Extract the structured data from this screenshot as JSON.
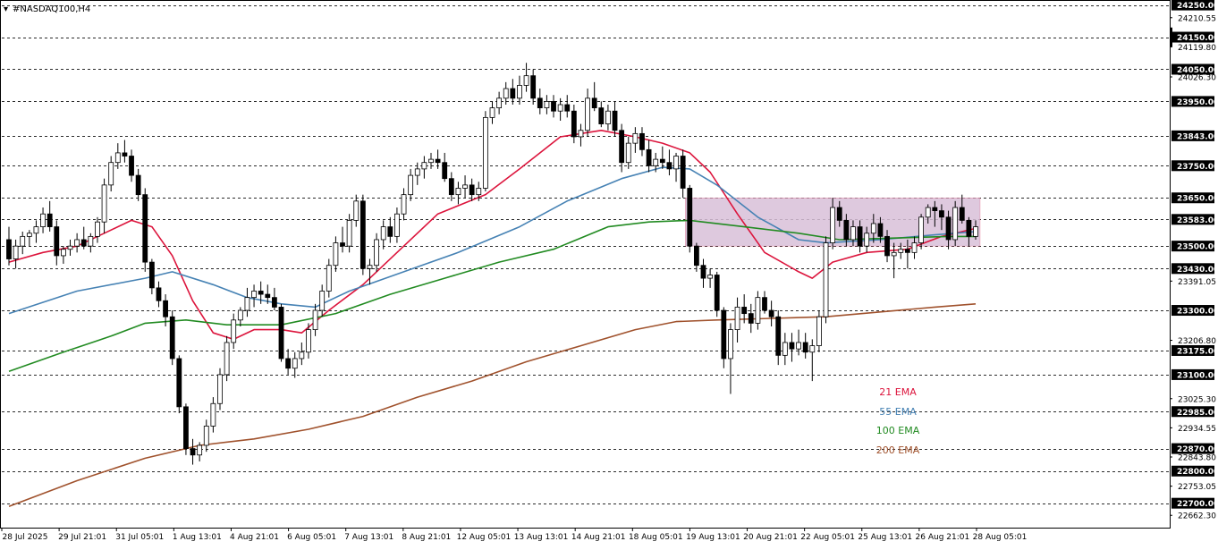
{
  "window": {
    "title": "#NASDAQ100,H4"
  },
  "colors": {
    "background": "#ffffff",
    "grid": "#2b2b2b",
    "candle_bull_fill": "#ffffff",
    "candle_bear_fill": "#000000",
    "candle_outline": "#000000",
    "ema21": "#dc143c",
    "ema55": "#4682b4",
    "ema100": "#228b22",
    "ema200": "#a0522d",
    "zone_fill": "#d8bfd8",
    "level_label_bg": "#000000",
    "level_label_text": "#ffffff"
  },
  "chart_data": {
    "type": "candlestick",
    "symbol": "#NASDAQ100",
    "timeframe": "H4",
    "ylim": [
      22624,
      24260
    ],
    "y_ticks": [
      "24210.55",
      "24119.80",
      "24026.30",
      "23391.05",
      "23206.80",
      "23025.30",
      "22934.55",
      "22843.80",
      "22753.05",
      "22662.30"
    ],
    "horizontal_levels": [
      {
        "value": 24250.0,
        "label": "24250.00"
      },
      {
        "value": 24150.0,
        "label": "24150.00"
      },
      {
        "value": 24050.0,
        "label": "24050.00"
      },
      {
        "value": 23950.0,
        "label": "23950.00"
      },
      {
        "value": 23843.0,
        "label": "23843.00"
      },
      {
        "value": 23750.0,
        "label": "23750.00"
      },
      {
        "value": 23650.0,
        "label": "23650.00"
      },
      {
        "value": 23583.0,
        "label": "23583.00"
      },
      {
        "value": 23500.0,
        "label": "23500.00"
      },
      {
        "value": 23430.0,
        "label": "23430.00"
      },
      {
        "value": 23300.0,
        "label": "23300.00"
      },
      {
        "value": 23175.0,
        "label": "23175.00"
      },
      {
        "value": 23100.0,
        "label": "23100.00"
      },
      {
        "value": 22985.0,
        "label": "22985.00"
      },
      {
        "value": 22870.0,
        "label": "22870.00"
      },
      {
        "value": 22800.0,
        "label": "22800.00"
      },
      {
        "value": 22700.0,
        "label": "22700.00"
      }
    ],
    "x_tick_labels": [
      "28 Jul 2025",
      "29 Jul 21:01",
      "31 Jul 05:01",
      "1 Aug 13:01",
      "4 Aug 21:01",
      "6 Aug 05:01",
      "7 Aug 13:01",
      "8 Aug 21:01",
      "12 Aug 05:01",
      "13 Aug 13:01",
      "14 Aug 21:01",
      "18 Aug 05:01",
      "19 Aug 13:01",
      "20 Aug 21:01",
      "22 Aug 05:01",
      "25 Aug 13:01",
      "26 Aug 21:01",
      "28 Aug 05:01"
    ],
    "candles": [
      [
        23520,
        23560,
        23440,
        23460
      ],
      [
        23460,
        23520,
        23430,
        23500
      ],
      [
        23500,
        23545,
        23475,
        23530
      ],
      [
        23530,
        23550,
        23500,
        23540
      ],
      [
        23540,
        23580,
        23510,
        23560
      ],
      [
        23560,
        23620,
        23540,
        23600
      ],
      [
        23600,
        23640,
        23545,
        23560
      ],
      [
        23560,
        23580,
        23440,
        23470
      ],
      [
        23470,
        23500,
        23445,
        23490
      ],
      [
        23490,
        23520,
        23470,
        23500
      ],
      [
        23500,
        23540,
        23480,
        23520
      ],
      [
        23520,
        23560,
        23490,
        23500
      ],
      [
        23500,
        23540,
        23480,
        23530
      ],
      [
        23530,
        23590,
        23510,
        23575
      ],
      [
        23575,
        23710,
        23540,
        23690
      ],
      [
        23690,
        23780,
        23670,
        23760
      ],
      [
        23760,
        23820,
        23740,
        23790
      ],
      [
        23790,
        23830,
        23760,
        23780
      ],
      [
        23780,
        23800,
        23700,
        23720
      ],
      [
        23720,
        23740,
        23640,
        23660
      ],
      [
        23660,
        23680,
        23420,
        23450
      ],
      [
        23450,
        23460,
        23350,
        23370
      ],
      [
        23370,
        23390,
        23310,
        23330
      ],
      [
        23330,
        23350,
        23250,
        23280
      ],
      [
        23280,
        23300,
        23130,
        23150
      ],
      [
        23150,
        23160,
        22980,
        23000
      ],
      [
        23000,
        23010,
        22850,
        22870
      ],
      [
        22870,
        22900,
        22820,
        22850
      ],
      [
        22850,
        22890,
        22830,
        22880
      ],
      [
        22880,
        22960,
        22860,
        22940
      ],
      [
        22940,
        23030,
        22920,
        23010
      ],
      [
        23010,
        23120,
        22990,
        23100
      ],
      [
        23100,
        23220,
        23080,
        23200
      ],
      [
        23200,
        23290,
        23180,
        23270
      ],
      [
        23270,
        23310,
        23250,
        23300
      ],
      [
        23300,
        23370,
        23280,
        23340
      ],
      [
        23340,
        23380,
        23310,
        23360
      ],
      [
        23360,
        23390,
        23320,
        23350
      ],
      [
        23350,
        23380,
        23320,
        23340
      ],
      [
        23340,
        23370,
        23300,
        23310
      ],
      [
        23310,
        23320,
        23140,
        23150
      ],
      [
        23150,
        23180,
        23100,
        23120
      ],
      [
        23120,
        23170,
        23090,
        23150
      ],
      [
        23150,
        23200,
        23130,
        23170
      ],
      [
        23170,
        23260,
        23150,
        23240
      ],
      [
        23240,
        23320,
        23220,
        23300
      ],
      [
        23300,
        23380,
        23280,
        23360
      ],
      [
        23360,
        23460,
        23340,
        23440
      ],
      [
        23440,
        23530,
        23420,
        23510
      ],
      [
        23510,
        23560,
        23480,
        23500
      ],
      [
        23500,
        23600,
        23480,
        23580
      ],
      [
        23580,
        23660,
        23560,
        23640
      ],
      [
        23640,
        23660,
        23410,
        23430
      ],
      [
        23430,
        23460,
        23380,
        23440
      ],
      [
        23440,
        23540,
        23420,
        23520
      ],
      [
        23520,
        23580,
        23490,
        23560
      ],
      [
        23560,
        23590,
        23510,
        23530
      ],
      [
        23530,
        23620,
        23510,
        23600
      ],
      [
        23600,
        23680,
        23580,
        23660
      ],
      [
        23660,
        23740,
        23640,
        23720
      ],
      [
        23720,
        23760,
        23690,
        23740
      ],
      [
        23740,
        23780,
        23710,
        23760
      ],
      [
        23760,
        23790,
        23740,
        23770
      ],
      [
        23770,
        23800,
        23740,
        23760
      ],
      [
        23760,
        23790,
        23700,
        23710
      ],
      [
        23710,
        23730,
        23640,
        23660
      ],
      [
        23660,
        23700,
        23630,
        23680
      ],
      [
        23680,
        23720,
        23650,
        23690
      ],
      [
        23690,
        23710,
        23640,
        23660
      ],
      [
        23660,
        23700,
        23640,
        23680
      ],
      [
        23680,
        23920,
        23670,
        23900
      ],
      [
        23900,
        23950,
        23880,
        23930
      ],
      [
        23930,
        23980,
        23910,
        23960
      ],
      [
        23960,
        24010,
        23940,
        23990
      ],
      [
        23990,
        24020,
        23940,
        23960
      ],
      [
        23960,
        24030,
        23940,
        24000
      ],
      [
        24000,
        24070,
        23980,
        24030
      ],
      [
        24030,
        24050,
        23940,
        23960
      ],
      [
        23960,
        23990,
        23910,
        23930
      ],
      [
        23930,
        23970,
        23910,
        23950
      ],
      [
        23950,
        23970,
        23900,
        23920
      ],
      [
        23920,
        23960,
        23890,
        23940
      ],
      [
        23940,
        23970,
        23900,
        23920
      ],
      [
        23920,
        23940,
        23820,
        23840
      ],
      [
        23840,
        23880,
        23810,
        23860
      ],
      [
        23860,
        23990,
        23840,
        23960
      ],
      [
        23960,
        24010,
        23920,
        23930
      ],
      [
        23930,
        23950,
        23870,
        23880
      ],
      [
        23880,
        23940,
        23860,
        23920
      ],
      [
        23920,
        23950,
        23840,
        23860
      ],
      [
        23860,
        23880,
        23730,
        23760
      ],
      [
        23760,
        23840,
        23740,
        23820
      ],
      [
        23820,
        23870,
        23790,
        23850
      ],
      [
        23850,
        23870,
        23780,
        23800
      ],
      [
        23800,
        23830,
        23730,
        23750
      ],
      [
        23750,
        23790,
        23730,
        23770
      ],
      [
        23770,
        23810,
        23740,
        23760
      ],
      [
        23760,
        23800,
        23720,
        23740
      ],
      [
        23740,
        23790,
        23700,
        23780
      ],
      [
        23780,
        23800,
        23650,
        23680
      ],
      [
        23680,
        23690,
        23480,
        23500
      ],
      [
        23500,
        23510,
        23420,
        23440
      ],
      [
        23440,
        23460,
        23370,
        23400
      ],
      [
        23400,
        23430,
        23370,
        23410
      ],
      [
        23410,
        23420,
        23280,
        23300
      ],
      [
        23300,
        23310,
        23120,
        23150
      ],
      [
        23150,
        23260,
        23040,
        23240
      ],
      [
        23240,
        23340,
        23200,
        23310
      ],
      [
        23310,
        23350,
        23260,
        23290
      ],
      [
        23290,
        23320,
        23230,
        23260
      ],
      [
        23260,
        23360,
        23240,
        23340
      ],
      [
        23340,
        23360,
        23290,
        23300
      ],
      [
        23300,
        23330,
        23250,
        23280
      ],
      [
        23280,
        23300,
        23130,
        23160
      ],
      [
        23160,
        23230,
        23130,
        23200
      ],
      [
        23200,
        23230,
        23140,
        23180
      ],
      [
        23180,
        23240,
        23160,
        23200
      ],
      [
        23200,
        23230,
        23150,
        23170
      ],
      [
        23170,
        23210,
        23080,
        23190
      ],
      [
        23190,
        23300,
        23170,
        23280
      ],
      [
        23280,
        23530,
        23260,
        23510
      ],
      [
        23510,
        23650,
        23490,
        23620
      ],
      [
        23620,
        23640,
        23560,
        23580
      ],
      [
        23580,
        23600,
        23500,
        23520
      ],
      [
        23520,
        23580,
        23500,
        23560
      ],
      [
        23560,
        23580,
        23480,
        23500
      ],
      [
        23500,
        23560,
        23480,
        23540
      ],
      [
        23540,
        23600,
        23510,
        23570
      ],
      [
        23570,
        23590,
        23510,
        23530
      ],
      [
        23530,
        23550,
        23450,
        23470
      ],
      [
        23470,
        23510,
        23400,
        23480
      ],
      [
        23480,
        23510,
        23460,
        23490
      ],
      [
        23490,
        23520,
        23430,
        23480
      ],
      [
        23480,
        23530,
        23460,
        23510
      ],
      [
        23510,
        23600,
        23490,
        23590
      ],
      [
        23590,
        23630,
        23570,
        23620
      ],
      [
        23620,
        23640,
        23560,
        23610
      ],
      [
        23610,
        23630,
        23550,
        23590
      ],
      [
        23590,
        23610,
        23490,
        23520
      ],
      [
        23520,
        23640,
        23500,
        23620
      ],
      [
        23620,
        23660,
        23570,
        23580
      ],
      [
        23580,
        23590,
        23500,
        23530
      ],
      [
        23530,
        23580,
        23520,
        23560
      ]
    ],
    "series": [
      {
        "name": "21 EMA",
        "color": "#dc143c",
        "values": [
          [
            0,
            23450
          ],
          [
            5,
            23480
          ],
          [
            10,
            23500
          ],
          [
            14,
            23540
          ],
          [
            18,
            23580
          ],
          [
            21,
            23560
          ],
          [
            24,
            23470
          ],
          [
            27,
            23330
          ],
          [
            30,
            23230
          ],
          [
            33,
            23210
          ],
          [
            36,
            23240
          ],
          [
            40,
            23240
          ],
          [
            43,
            23230
          ],
          [
            47,
            23300
          ],
          [
            52,
            23380
          ],
          [
            58,
            23500
          ],
          [
            63,
            23600
          ],
          [
            70,
            23660
          ],
          [
            75,
            23740
          ],
          [
            81,
            23840
          ],
          [
            87,
            23860
          ],
          [
            92,
            23840
          ],
          [
            96,
            23820
          ],
          [
            100,
            23790
          ],
          [
            103,
            23730
          ],
          [
            107,
            23600
          ],
          [
            111,
            23480
          ],
          [
            116,
            23420
          ],
          [
            118,
            23400
          ],
          [
            121,
            23450
          ],
          [
            126,
            23480
          ],
          [
            132,
            23490
          ],
          [
            137,
            23530
          ],
          [
            142,
            23555
          ]
        ]
      },
      {
        "name": "55 EMA",
        "color": "#4682b4",
        "values": [
          [
            0,
            23290
          ],
          [
            10,
            23360
          ],
          [
            20,
            23400
          ],
          [
            24,
            23420
          ],
          [
            30,
            23380
          ],
          [
            35,
            23340
          ],
          [
            40,
            23320
          ],
          [
            45,
            23310
          ],
          [
            50,
            23360
          ],
          [
            58,
            23420
          ],
          [
            66,
            23480
          ],
          [
            75,
            23560
          ],
          [
            82,
            23640
          ],
          [
            90,
            23710
          ],
          [
            96,
            23745
          ],
          [
            100,
            23740
          ],
          [
            104,
            23690
          ],
          [
            110,
            23590
          ],
          [
            116,
            23520
          ],
          [
            120,
            23510
          ],
          [
            128,
            23520
          ],
          [
            136,
            23535
          ],
          [
            142,
            23545
          ]
        ]
      },
      {
        "name": "100 EMA",
        "color": "#228b22",
        "values": [
          [
            0,
            23110
          ],
          [
            8,
            23170
          ],
          [
            15,
            23220
          ],
          [
            20,
            23260
          ],
          [
            26,
            23270
          ],
          [
            32,
            23255
          ],
          [
            40,
            23255
          ],
          [
            48,
            23290
          ],
          [
            56,
            23350
          ],
          [
            64,
            23400
          ],
          [
            72,
            23450
          ],
          [
            80,
            23490
          ],
          [
            88,
            23560
          ],
          [
            94,
            23575
          ],
          [
            100,
            23580
          ],
          [
            108,
            23560
          ],
          [
            116,
            23540
          ],
          [
            122,
            23520
          ],
          [
            130,
            23525
          ],
          [
            138,
            23530
          ],
          [
            142,
            23530
          ]
        ]
      },
      {
        "name": "200 EMA",
        "color": "#a0522d",
        "values": [
          [
            0,
            22690
          ],
          [
            10,
            22770
          ],
          [
            20,
            22840
          ],
          [
            28,
            22880
          ],
          [
            36,
            22900
          ],
          [
            44,
            22930
          ],
          [
            52,
            22970
          ],
          [
            60,
            23030
          ],
          [
            68,
            23080
          ],
          [
            76,
            23140
          ],
          [
            84,
            23190
          ],
          [
            92,
            23240
          ],
          [
            98,
            23265
          ],
          [
            104,
            23270
          ],
          [
            112,
            23275
          ],
          [
            120,
            23280
          ],
          [
            128,
            23295
          ],
          [
            136,
            23310
          ],
          [
            142,
            23320
          ]
        ]
      }
    ],
    "zone": {
      "x_start": 100,
      "x_end": 142,
      "y_low": 23500,
      "y_high": 23650
    },
    "legend": {
      "placement": "bottom-right",
      "entries": [
        "21 EMA",
        "55 EMA",
        "100 EMA",
        "200 EMA"
      ]
    },
    "grid": "dashed horizontal at marked levels"
  }
}
